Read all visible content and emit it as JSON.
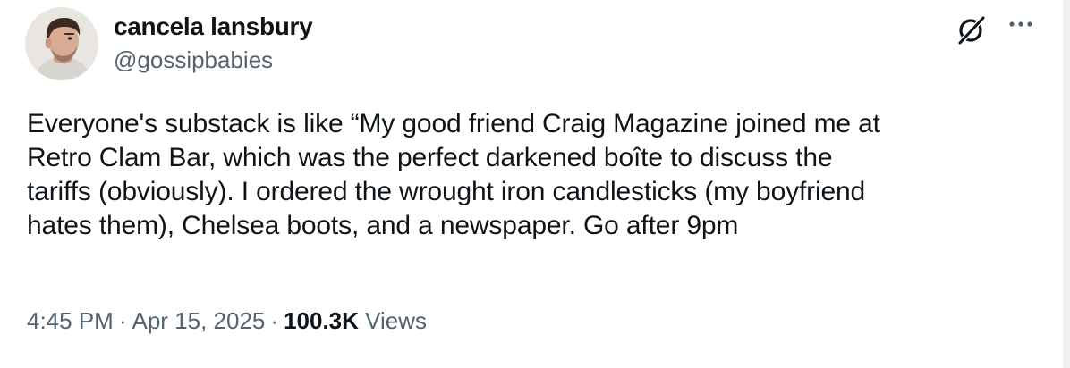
{
  "author": {
    "display_name": "cancela lansbury",
    "handle": "@gossipbabies"
  },
  "icons": {
    "grok": "grok-icon",
    "more": "more-icon",
    "avatar": "avatar-image"
  },
  "tweet": {
    "text": "Everyone's substack is like “My good friend Craig Magazine joined me at\nRetro Clam Bar, which was the perfect darkened boîte to discuss the\ntariffs (obviously). I ordered the wrought iron candlesticks (my boyfriend\nhates them), Chelsea boots, and a newspaper. Go after 9pm"
  },
  "meta": {
    "time": "4:45 PM",
    "separator": "·",
    "date": "Apr 15, 2025",
    "views_count": "100.3K",
    "views_label": "Views"
  },
  "colors": {
    "text": "#0f1419",
    "secondary": "#536471",
    "background": "#ffffff"
  }
}
